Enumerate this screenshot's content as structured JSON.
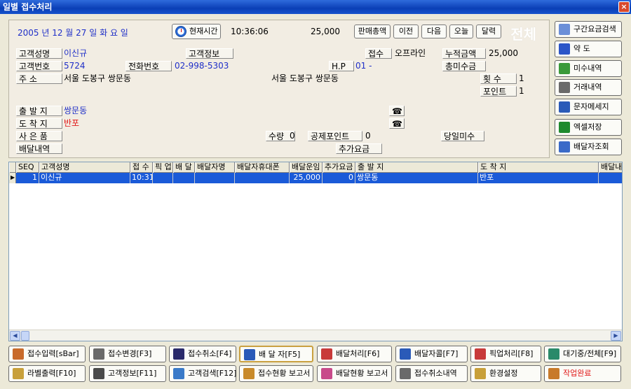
{
  "window": {
    "title": "일별 접수처리",
    "close": "×"
  },
  "header": {
    "date": "2005 년   12 월  27 일  화 요 일",
    "current_time_button": "현재시간",
    "time": "10:36:06",
    "amount": "25,000",
    "nav": {
      "sales_total": "판매총액",
      "prev": "이전",
      "next": "다음",
      "today": "오늘",
      "calendar": "달력"
    },
    "watermark": "전체"
  },
  "fields": {
    "customer_name_label": "고객성명",
    "customer_name": "이신규",
    "customer_info_label": "고객정보",
    "reception_label": "접수",
    "reception_value": "오프라인",
    "cumulative_label": "누적금액",
    "cumulative_value": "25,000",
    "customer_no_label": "고객번호",
    "customer_no": "5724",
    "phone_label": "전화번호",
    "phone": "02-998-5303",
    "hp_label": "H.P",
    "hp_value": "01 -",
    "unpaid_label": "총미수금",
    "address_label": "주      소",
    "address": "서울 도봉구 쌍문동",
    "address2": "서울 도봉구 쌍문동",
    "count_label": "횟    수",
    "count_value": "1",
    "points_label": "포인트",
    "points_value": "1",
    "origin_label": "출 발 지",
    "origin": "쌍문동",
    "dest_label": "도 착 지",
    "dest": "반포",
    "goods_label": "사 은 품",
    "qty_label": "수량",
    "qty_value": "0",
    "deduct_label": "공제포인트",
    "deduct_value": "0",
    "day_unpaid_label": "당일미수",
    "delivery_label": "배달내역",
    "extra_fee_label": "추가요금",
    "tel_icon1": "☎",
    "tel_icon2": "☎"
  },
  "right_buttons": [
    {
      "label": "구간요금검색",
      "icon": "search-person-icon",
      "color": "#6b8fd8"
    },
    {
      "label": "약 도",
      "icon": "map-icon",
      "color": "#2b55c8"
    },
    {
      "label": "미수내역",
      "icon": "receipt-icon",
      "color": "#3a9a3a"
    },
    {
      "label": "거래내역",
      "icon": "document-icon",
      "color": "#6a6a6a"
    },
    {
      "label": "문자메세지",
      "icon": "message-icon",
      "color": "#2a5ab8"
    },
    {
      "label": "엑셀저장",
      "icon": "excel-icon",
      "color": "#1e8a2e"
    },
    {
      "label": "배달자조회",
      "icon": "people-icon",
      "color": "#3a6ac8"
    }
  ],
  "grid": {
    "columns": [
      "SEQ",
      "고객성명",
      "접 수",
      "픽 업",
      "배 달",
      "배달자명",
      "배달자휴대폰",
      "배달운임",
      "추가요금",
      "출 발 지",
      "도 착 지",
      "배달내역"
    ],
    "rows": [
      [
        "1",
        "이신규",
        "10:31",
        "",
        "",
        "",
        "",
        "25,000",
        "0",
        "쌍문동",
        "반포",
        ""
      ]
    ]
  },
  "bottom_row1": [
    {
      "label": "접수입력[sBar]",
      "icon": "edit-icon",
      "color": "#c86a2a"
    },
    {
      "label": "접수변경[F3]",
      "icon": "change-icon",
      "color": "#6a6a6a"
    },
    {
      "label": "접수취소[F4]",
      "icon": "floppy-icon",
      "color": "#2a2a6a"
    },
    {
      "label": "배 달 자[F5]",
      "icon": "courier-icon",
      "color": "#2a5ab8"
    },
    {
      "label": "배달처리[F6]",
      "icon": "process-icon",
      "color": "#c83a3a"
    },
    {
      "label": "배달자콜[F7]",
      "icon": "call-icon",
      "color": "#2a5ab8"
    },
    {
      "label": "픽업처리[F8]",
      "icon": "pickup-icon",
      "color": "#c83a3a"
    },
    {
      "label": "대기중/전체[F9]",
      "icon": "list-icon",
      "color": "#2a8a6a"
    }
  ],
  "bottom_row2": [
    {
      "label": "라벨출력[F10]",
      "icon": "printer-icon",
      "color": "#c8a03a"
    },
    {
      "label": "고객정보[F11]",
      "icon": "customer-icon",
      "color": "#4a4a4a"
    },
    {
      "label": "고객검색[F12]",
      "icon": "magnifier-icon",
      "color": "#3a7ac8"
    },
    {
      "label": "접수현황 보고서",
      "icon": "report-icon",
      "color": "#c88a2a"
    },
    {
      "label": "배달현황 보고서",
      "icon": "report2-icon",
      "color": "#c84a8a"
    },
    {
      "label": "접수취소내역",
      "icon": "cancel-doc-icon",
      "color": "#6a6a6a"
    },
    {
      "label": "환경설정",
      "icon": "settings-icon",
      "color": "#c8a03a"
    },
    {
      "label": "작업완료",
      "icon": "door-icon",
      "color": "#c87a2a"
    }
  ],
  "colors": {
    "title": "#0a3fb6",
    "select": "#1a5ad8",
    "accent_red": "#e11818",
    "finish_text": "#e11818"
  }
}
